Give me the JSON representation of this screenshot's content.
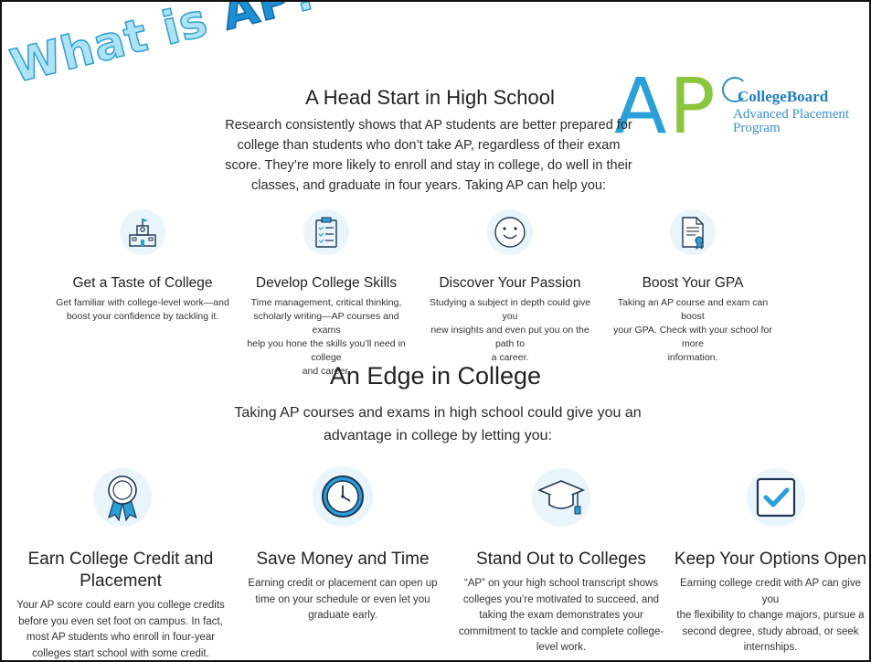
{
  "wordart": {
    "what": "What is ",
    "ap": "AP",
    "q": "?"
  },
  "logo": {
    "letter_a": "A",
    "letter_p": "P",
    "brand": "CollegeBoard",
    "line1": "Advanced Placement",
    "line2": "Program"
  },
  "section1": {
    "title": "A Head Start in High School",
    "intro_lines": [
      "Research consistently shows that AP students are better prepared for",
      "college than students who don’t take AP, regardless of their exam",
      "score. They’re more likely to enroll and stay in college, do well in their",
      "classes, and graduate in four years. Taking AP can help you:"
    ],
    "items": [
      {
        "icon": "school-building-icon",
        "title": "Get a Taste of College",
        "lines": [
          "Get familiar with college-level work—and",
          "boost your confidence by tackling it."
        ]
      },
      {
        "icon": "clipboard-checklist-icon",
        "title": "Develop College Skills",
        "lines": [
          "Time management, critical thinking,",
          "scholarly writing—AP courses and exams",
          "help you hone the skills you’ll need in college",
          "and career."
        ]
      },
      {
        "icon": "smiley-face-icon",
        "title": "Discover Your Passion",
        "lines": [
          "Studying a subject in depth could give you",
          "new insights and even put you on the path to",
          "a career."
        ]
      },
      {
        "icon": "certificate-document-icon",
        "title": "Boost Your GPA",
        "lines": [
          "Taking an AP course and exam can boost",
          "your GPA. Check with your school for more",
          "information."
        ]
      }
    ]
  },
  "section2": {
    "title": "An Edge in College",
    "intro_lines": [
      "Taking AP courses and exams in high school could give you an",
      "advantage in college by letting you:"
    ],
    "items": [
      {
        "icon": "award-ribbon-icon",
        "title_lines": [
          "Earn College Credit and",
          "Placement"
        ],
        "lines": [
          "Your AP score could earn you college credits",
          "before you even set foot on campus. In fact,",
          "most AP students who enroll in four-year",
          "colleges start school with some credit."
        ]
      },
      {
        "icon": "clock-icon",
        "title_lines": [
          "Save Money and Time"
        ],
        "lines": [
          "Earning credit or placement can open up",
          "time on your schedule or even let you",
          "graduate early."
        ]
      },
      {
        "icon": "graduation-cap-icon",
        "title_lines": [
          "Stand Out to Colleges"
        ],
        "lines": [
          "“AP” on your high school transcript shows",
          "colleges you’re motivated to succeed, and",
          "taking the exam demonstrates your",
          "commitment to tackle and complete college-",
          "level work."
        ]
      },
      {
        "icon": "checkbox-icon",
        "title_lines": [
          "Keep Your Options Open"
        ],
        "lines": [
          "Earning college credit with AP can give you",
          "the flexibility to change majors, pursue a",
          "second degree, study abroad, or seek",
          "internships."
        ]
      }
    ]
  },
  "colors": {
    "blue": "#2a9fd9",
    "green": "#8cc63f",
    "icon_bg": "#eaf4fb",
    "dark_navy": "#1f3553"
  }
}
